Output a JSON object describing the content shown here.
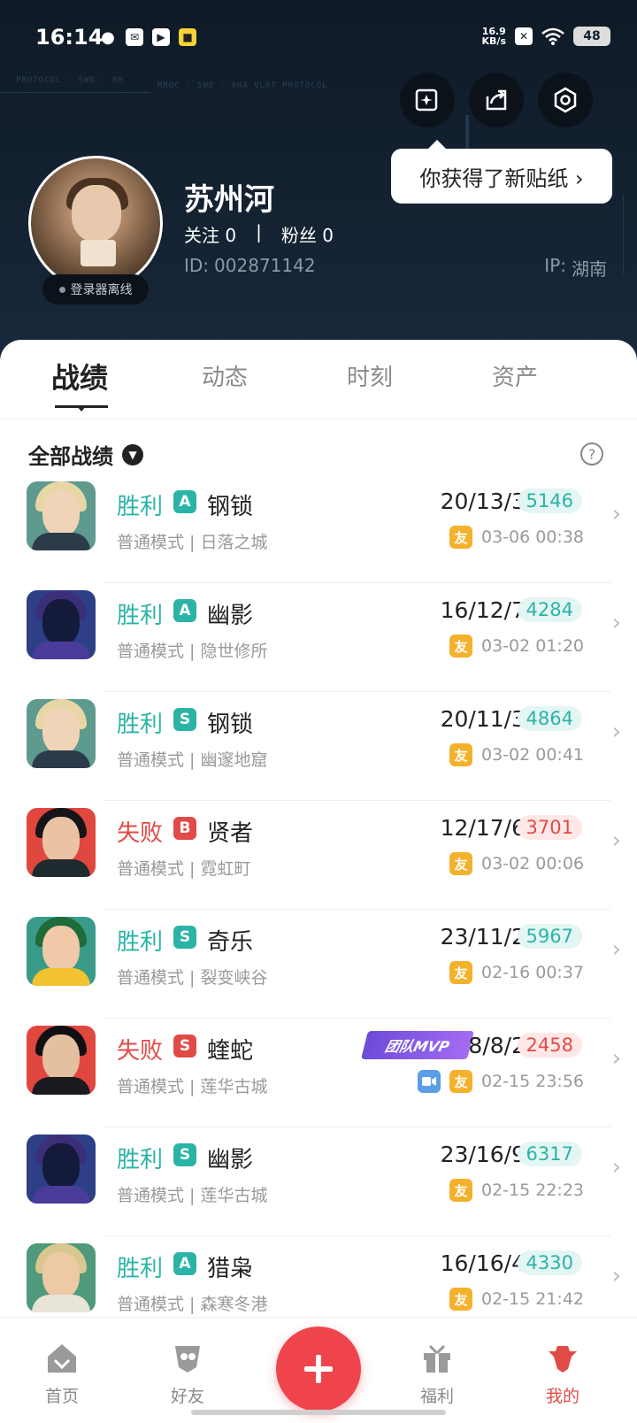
{
  "status_bar": {
    "time": "16:14",
    "net_speed_value": "16.9",
    "net_speed_unit": "KB/s",
    "battery": "48"
  },
  "header": {
    "tooltip": "你获得了新贴纸 ›",
    "username": "苏州河",
    "follow_label": "关注",
    "follow_count": "0",
    "follow_sep": "|",
    "fans_label": "粉丝",
    "fans_count": "0",
    "id_label": "ID:",
    "id_value": "002871142",
    "ip_label": "IP:",
    "ip_value": "湖南",
    "login_status": "登录器离线"
  },
  "tabs": [
    "战绩",
    "动态",
    "时刻",
    "资产"
  ],
  "filter": {
    "label": "全部战绩"
  },
  "matches": [
    {
      "result": "胜利",
      "outcome": "win",
      "grade": "A",
      "agent": "钢锁",
      "mode": "普通模式 | 日落之城",
      "kda": "20/13/3",
      "score": "5146",
      "time": "03-06 00:38"
    },
    {
      "result": "胜利",
      "outcome": "win",
      "grade": "A",
      "agent": "幽影",
      "mode": "普通模式 | 隐世修所",
      "kda": "16/12/7",
      "score": "4284",
      "time": "03-02 01:20"
    },
    {
      "result": "胜利",
      "outcome": "win",
      "grade": "S",
      "agent": "钢锁",
      "mode": "普通模式 | 幽邃地窟",
      "kda": "20/11/3",
      "score": "4864",
      "time": "03-02 00:41"
    },
    {
      "result": "失败",
      "outcome": "lose",
      "grade": "B",
      "agent": "贤者",
      "mode": "普通模式 | 霓虹町",
      "kda": "12/17/6",
      "score": "3701",
      "time": "03-02 00:06"
    },
    {
      "result": "胜利",
      "outcome": "win",
      "grade": "S",
      "agent": "奇乐",
      "mode": "普通模式 | 裂变峡谷",
      "kda": "23/11/2",
      "score": "5967",
      "time": "02-16 00:37"
    },
    {
      "result": "失败",
      "outcome": "lose",
      "grade": "S",
      "agent": "蝰蛇",
      "mode": "普通模式 | 莲华古城",
      "kda": "8/8/2",
      "score": "2458",
      "time": "02-15 23:56",
      "badge": "团队MVP"
    },
    {
      "result": "胜利",
      "outcome": "win",
      "grade": "S",
      "agent": "幽影",
      "mode": "普通模式 | 莲华古城",
      "kda": "23/16/9",
      "score": "6317",
      "time": "02-15 22:23"
    },
    {
      "result": "胜利",
      "outcome": "win",
      "grade": "A",
      "agent": "猎枭",
      "mode": "普通模式 | 森寒冬港",
      "kda": "16/16/4",
      "score": "4330",
      "time": "02-15 21:42"
    }
  ],
  "friend_badge": "友",
  "bottom_nav": {
    "home": "首页",
    "friends": "好友",
    "welfare": "福利",
    "mine": "我的"
  },
  "colors": {
    "win": "#2bb3a7",
    "lose": "#e14b47",
    "accent": "#f0444c",
    "header_bg": "#142232"
  }
}
